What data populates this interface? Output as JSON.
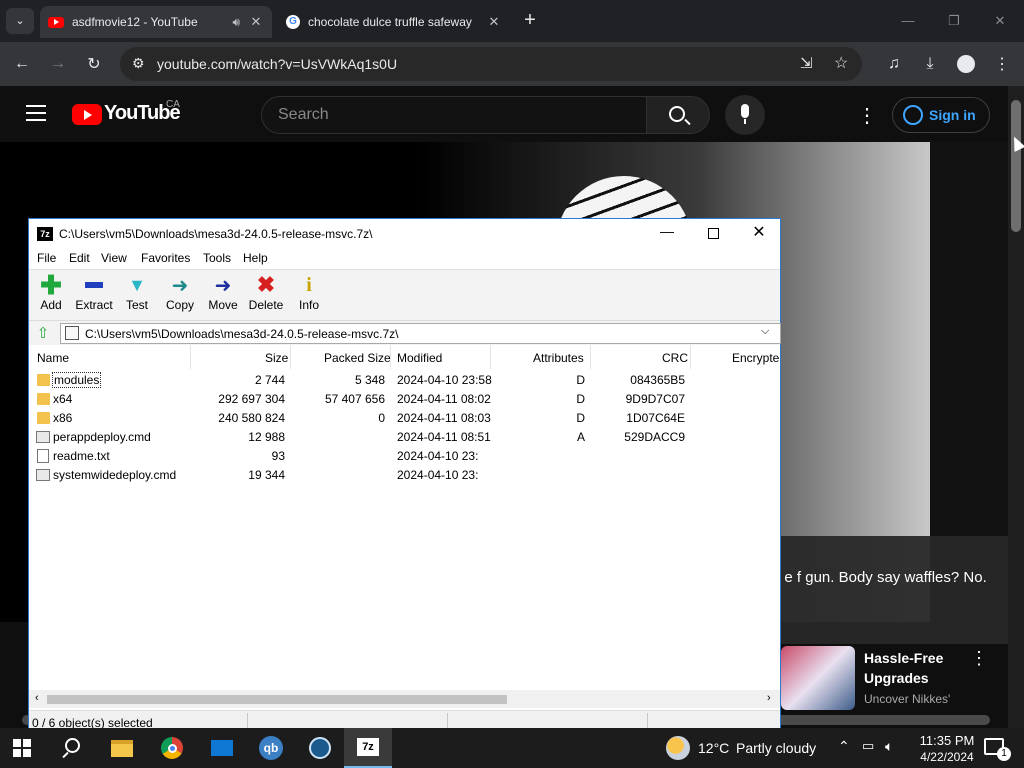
{
  "browser": {
    "tabs": [
      {
        "title": "asdfmovie12 - YouTube",
        "icon": "youtube-favicon"
      },
      {
        "title": "chocolate dulce truffle safeway",
        "icon": "google-favicon"
      }
    ],
    "url": "youtube.com/watch?v=UsVWkAq1s0U"
  },
  "youtube": {
    "logo_text": "YouTube",
    "country": "CA",
    "search_placeholder": "Search",
    "signin": "Sign in",
    "caption": "skin. I'm gay. I have no sun. House a b c d, e f gun. Body say waffles? No. I have brain damage.",
    "sidebar_video": {
      "title": "Hassle-Free Upgrades",
      "channel": "Uncover Nikkes'"
    }
  },
  "sevenzip": {
    "title": "C:\\Users\\vm5\\Downloads\\mesa3d-24.0.5-release-msvc.7z\\",
    "menu": [
      "File",
      "Edit",
      "View",
      "Favorites",
      "Tools",
      "Help"
    ],
    "tools": [
      {
        "label": "Add",
        "icon": "add-icon",
        "color": "#1fa83c"
      },
      {
        "label": "Extract",
        "icon": "extract-icon",
        "color": "#1f3fbf"
      },
      {
        "label": "Test",
        "icon": "test-icon",
        "color": "#2ab6c8"
      },
      {
        "label": "Copy",
        "icon": "copy-icon",
        "color": "#1f8a8a"
      },
      {
        "label": "Move",
        "icon": "move-icon",
        "color": "#1d2f9f"
      },
      {
        "label": "Delete",
        "icon": "delete-icon",
        "color": "#d81f1f"
      },
      {
        "label": "Info",
        "icon": "info-icon",
        "color": "#c8a400"
      }
    ],
    "path": "C:\\Users\\vm5\\Downloads\\mesa3d-24.0.5-release-msvc.7z\\",
    "columns": [
      "Name",
      "Size",
      "Packed Size",
      "Modified",
      "Attributes",
      "CRC",
      "Encrypte"
    ],
    "files": [
      {
        "name": "modules",
        "size": "2 744",
        "packed": "5 348",
        "modified": "2024-04-10 23:58",
        "attr": "D",
        "crc": "084365B5",
        "type": "folder"
      },
      {
        "name": "x64",
        "size": "292 697 304",
        "packed": "57 407 656",
        "modified": "2024-04-11 08:02",
        "attr": "D",
        "crc": "9D9D7C07",
        "type": "folder"
      },
      {
        "name": "x86",
        "size": "240 580 824",
        "packed": "0",
        "modified": "2024-04-11 08:03",
        "attr": "D",
        "crc": "1D07C64E",
        "type": "folder"
      },
      {
        "name": "perappdeploy.cmd",
        "size": "12 988",
        "packed": "",
        "modified": "2024-04-11 08:51",
        "attr": "A",
        "crc": "529DACC9",
        "type": "cmd"
      },
      {
        "name": "readme.txt",
        "size": "93",
        "packed": "",
        "modified": "2024-04-10 23:",
        "attr": "",
        "crc": "",
        "type": "txt"
      },
      {
        "name": "systemwidedeploy.cmd",
        "size": "19 344",
        "packed": "",
        "modified": "2024-04-10 23:",
        "attr": "",
        "crc": "",
        "type": "cmd"
      }
    ],
    "status": "0 / 6 object(s) selected"
  },
  "taskbar": {
    "weather_temp": "12°C",
    "weather_text": "Partly cloudy",
    "time": "11:35 PM",
    "date": "4/22/2024",
    "notifications": "1"
  }
}
